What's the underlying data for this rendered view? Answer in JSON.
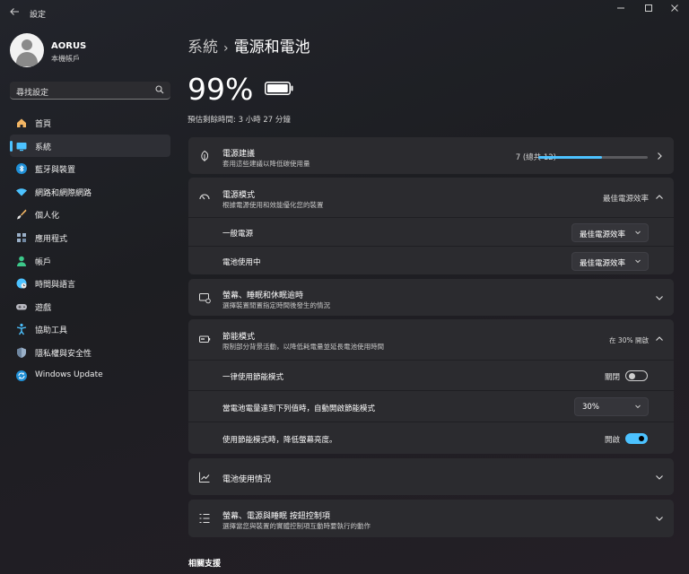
{
  "window": {
    "app_title": "設定"
  },
  "profile": {
    "name": "AORUS",
    "account_type": "本機帳戶"
  },
  "search": {
    "placeholder": "尋找設定"
  },
  "sidebar": {
    "items": [
      {
        "label": "首頁",
        "icon": "home-icon",
        "color": "#f3b664"
      },
      {
        "label": "系統",
        "icon": "monitor-icon",
        "color": "#4cc2ff",
        "active": true
      },
      {
        "label": "藍牙與裝置",
        "icon": "bluetooth-icon",
        "color": "#4cc2ff"
      },
      {
        "label": "網路和網際網路",
        "icon": "wifi-icon",
        "color": "#4cc2ff"
      },
      {
        "label": "個人化",
        "icon": "brush-icon",
        "color": "#f3b664"
      },
      {
        "label": "應用程式",
        "icon": "apps-icon",
        "color": "#9ab0c8"
      },
      {
        "label": "帳戶",
        "icon": "person-icon",
        "color": "#3cc88a"
      },
      {
        "label": "時間與語言",
        "icon": "globe-clock-icon",
        "color": "#4cc2ff"
      },
      {
        "label": "遊戲",
        "icon": "gamepad-icon",
        "color": "#b8b8c0"
      },
      {
        "label": "協助工具",
        "icon": "accessibility-icon",
        "color": "#4cc2ff"
      },
      {
        "label": "隱私權與安全性",
        "icon": "shield-icon",
        "color": "#9ab0c8"
      },
      {
        "label": "Windows Update",
        "icon": "update-icon",
        "color": "#4cc2ff"
      }
    ]
  },
  "breadcrumb": {
    "parent": "系統",
    "separator": "›",
    "current": "電源和電池"
  },
  "battery": {
    "percent": "99%",
    "level_fraction": 0.99,
    "time_remaining": "預估剩餘時間: 3 小時 27 分鐘"
  },
  "power_recommendations": {
    "title": "電源建議",
    "desc": "套用這些建議以降低碳使用量",
    "value": "7 (總共 12)",
    "progress_fraction": 0.58
  },
  "power_mode": {
    "title": "電源模式",
    "desc": "根據電源使用和效能優化您的裝置",
    "value": "最佳電源效率",
    "rows": [
      {
        "label": "一般電源",
        "selected": "最佳電源效率"
      },
      {
        "label": "電池使用中",
        "selected": "最佳電源效率"
      }
    ]
  },
  "screen_sleep": {
    "title": "螢幕、睡眠和休眠逾時",
    "desc": "選擇裝置閒置指定時間後發生的情況"
  },
  "energy_saver": {
    "title": "節能模式",
    "desc": "限制部分背景活動，以降低耗電量並延長電池使用時間",
    "value": "在 30% 開啟",
    "always_on": {
      "label": "一律使用節能模式",
      "state": "關閉",
      "on": false
    },
    "auto_threshold": {
      "label": "當電池電量達到下列值時，自動開啟節能模式",
      "selected": "30%"
    },
    "lower_brightness": {
      "label": "使用節能模式時，降低螢幕亮度。",
      "state": "開啟",
      "on": true
    }
  },
  "battery_usage": {
    "title": "電池使用情況"
  },
  "buttons_section": {
    "title": "螢幕、電源與睡眠 按鈕控制項",
    "desc": "選擇當您與裝置的實體控制項互動時要執行的動作"
  },
  "related": {
    "title": "相關支援"
  },
  "colors": {
    "accent": "#4cc2ff",
    "card_bg": "#2b2b2f"
  }
}
